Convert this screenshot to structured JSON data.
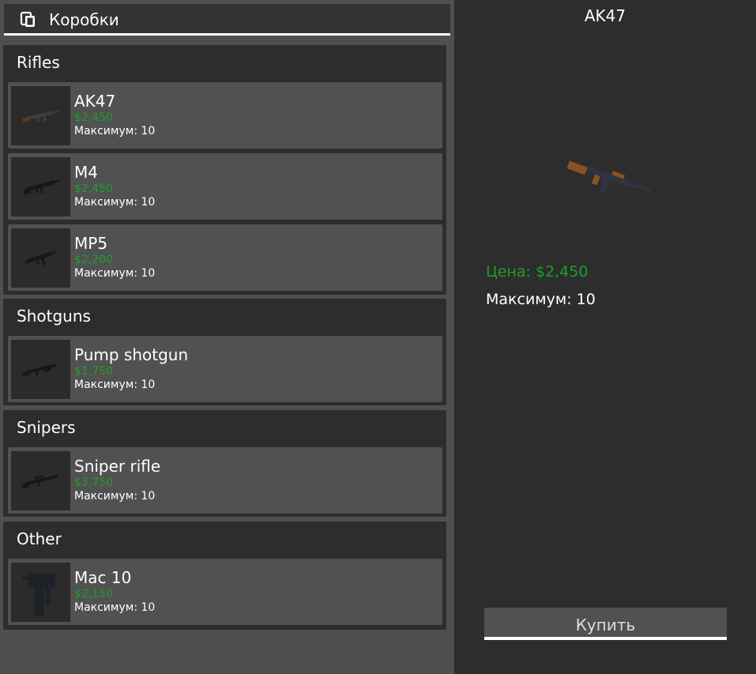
{
  "header": {
    "title": "Коробки",
    "icon": "copy-icon"
  },
  "categories": [
    {
      "title": "Rifles",
      "items": [
        {
          "name": "AK47",
          "price": "$2,450",
          "max": "Максимум: 10",
          "icon": "ak47-icon"
        },
        {
          "name": "M4",
          "price": "$2,450",
          "max": "Максимум: 10",
          "icon": "m4-icon"
        },
        {
          "name": "MP5",
          "price": "$2,200",
          "max": "Максимум: 10",
          "icon": "mp5-icon"
        }
      ]
    },
    {
      "title": "Shotguns",
      "items": [
        {
          "name": "Pump shotgun",
          "price": "$1,750",
          "max": "Максимум: 10",
          "icon": "shotgun-icon"
        }
      ]
    },
    {
      "title": "Snipers",
      "items": [
        {
          "name": "Sniper rifle",
          "price": "$3,750",
          "max": "Максимум: 10",
          "icon": "sniper-icon"
        }
      ]
    },
    {
      "title": "Other",
      "items": [
        {
          "name": "Mac 10",
          "price": "$2,150",
          "max": "Максимум: 10",
          "icon": "mac10-icon"
        }
      ]
    }
  ],
  "detail": {
    "title": "AK47",
    "price": "Цена: $2,450",
    "max": "Максимум: 10",
    "buy_label": "Купить",
    "icon": "ak47-icon"
  },
  "colors": {
    "price_green": "#1e9e2a",
    "panel": "#2d2d2d",
    "item": "#515151",
    "background": "#4f4f4f"
  }
}
